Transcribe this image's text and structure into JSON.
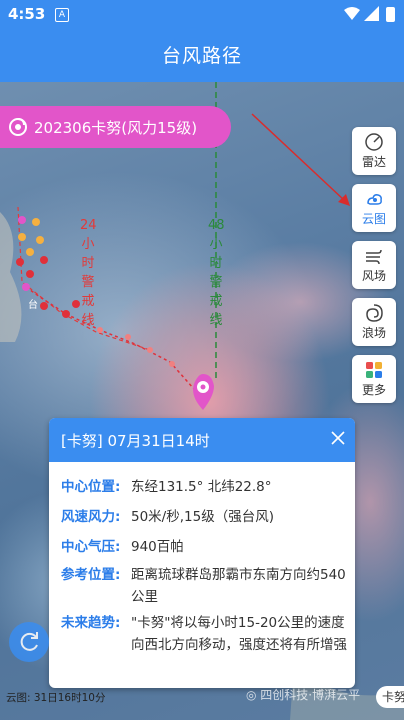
{
  "status_bar": {
    "time": "4:53",
    "notification_letter": "A"
  },
  "title_bar": {
    "title": "台风路径"
  },
  "map": {
    "warn_24_chars": [
      "24",
      "小",
      "时",
      "警",
      "戒",
      "线"
    ],
    "warn_48_chars": [
      "48",
      "小",
      "时",
      "警",
      "戒",
      "线"
    ],
    "place_label": "台",
    "colors": {
      "warn_24": "#e23a3a",
      "warn_48": "#2a8a3a",
      "track": "#e0303a",
      "current_marker": "#e255c9"
    }
  },
  "typhoon_pill": {
    "text": "202306卡努(风力15级)",
    "icon": "typhoon-icon"
  },
  "side_buttons": [
    {
      "label": "雷达",
      "icon": "radar-icon"
    },
    {
      "label": "云图",
      "icon": "cloud-image-icon",
      "active": true
    },
    {
      "label": "风场",
      "icon": "wind-field-icon"
    },
    {
      "label": "浪场",
      "icon": "wave-field-icon"
    },
    {
      "label": "更多",
      "icon": "more-icon"
    }
  ],
  "info_card": {
    "title": "[卡努] 07月31日14时",
    "rows": [
      {
        "label": "中心位置:",
        "value": "东经131.5°  北纬22.8°"
      },
      {
        "label": "风速风力:",
        "value": "50米/秒,15级（强台风)"
      },
      {
        "label": "中心气压:",
        "value": "940百帕"
      },
      {
        "label": "参考位置:",
        "value": "距离琉球群岛那霸市东南方向约540公里"
      },
      {
        "label": "未来趋势:",
        "value": "\"卡努\"将以每小时15-20公里的速度向西北方向移动，强度还将有所增强"
      }
    ]
  },
  "footer": {
    "cloud_time": "云图: 31日16时10分",
    "watermark": "◎ 四创科技·博湃云平",
    "tab_text": "卡努"
  }
}
